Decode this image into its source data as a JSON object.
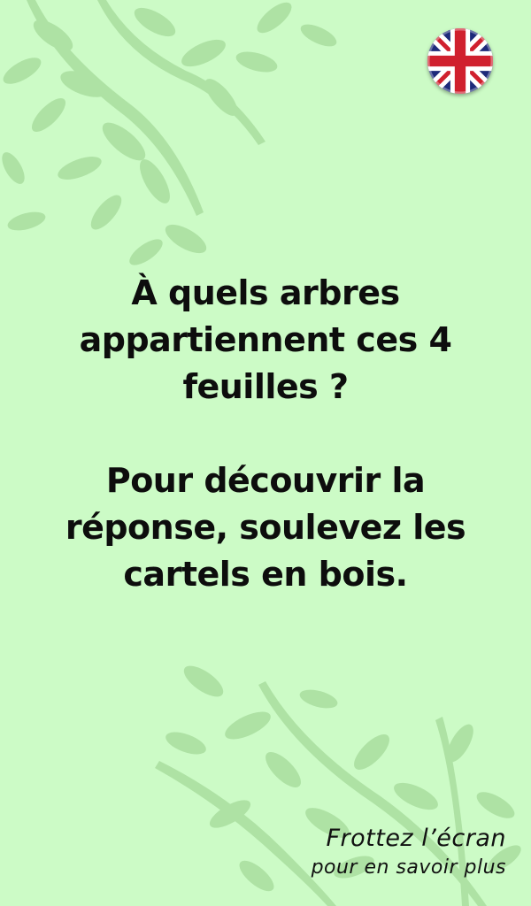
{
  "screen": {
    "background_color": "#ccfbc6",
    "foliage_color": "#a4dc9c"
  },
  "language_switch": {
    "icon": "uk-flag-icon"
  },
  "content": {
    "question": "À quels arbres\nappartiennent ces 4\nfeuilles ?",
    "instruction": "Pour découvrir la\nréponse, soulevez les\ncartels en bois."
  },
  "hint": {
    "line1": "Frottez l’écran",
    "line2": "pour en savoir plus"
  }
}
